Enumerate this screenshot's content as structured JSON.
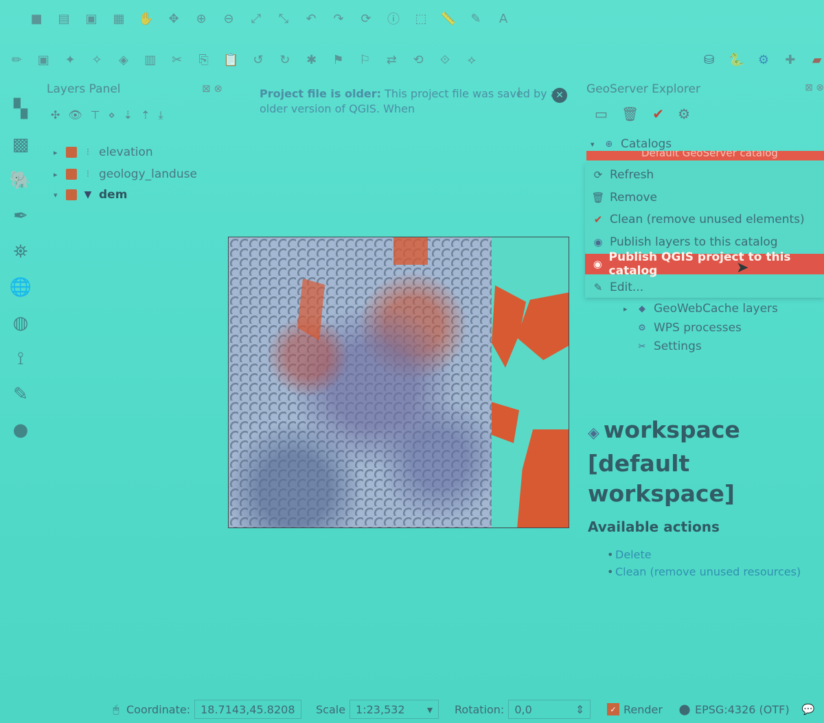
{
  "layers_panel": {
    "title": "Layers Panel",
    "layers": [
      {
        "name": "elevation"
      },
      {
        "name": "geology_landuse"
      },
      {
        "name": "dem"
      }
    ]
  },
  "message_bar": {
    "bold_text": "Project file is older:",
    "text": " This project file was saved by an older version of QGIS. When"
  },
  "geoserver_explorer": {
    "title": "GeoServer Explorer",
    "tree": {
      "catalogs_label": "Catalogs",
      "selected_catalog": "Default GeoServer catalog",
      "geowebcache_label": "GeoWebCache layers",
      "wps_label": "WPS processes",
      "settings_label": "Settings"
    },
    "context_menu": [
      {
        "label": "Refresh",
        "icon": "refresh-icon"
      },
      {
        "label": "Remove",
        "icon": "trash-icon"
      },
      {
        "label": "Clean (remove unused elements)",
        "icon": "broom-icon"
      },
      {
        "label": "Publish layers to this catalog",
        "icon": "publish-icon"
      },
      {
        "label": "Publish QGIS project to this catalog",
        "icon": "publish-project-icon"
      },
      {
        "label": "Edit...",
        "icon": "edit-icon"
      }
    ],
    "details": {
      "title_line1": "workspace",
      "title_line2": "[default workspace]",
      "actions_heading": "Available actions",
      "actions": [
        {
          "label": "Delete"
        },
        {
          "label": "Clean (remove unused resources)"
        }
      ]
    }
  },
  "status_bar": {
    "coordinate_label": "Coordinate:",
    "coordinate_value": "18.7143,45.8208",
    "scale_label": "Scale",
    "scale_value": "1:23,532",
    "rotation_label": "Rotation:",
    "rotation_value": "0,0",
    "render_label": "Render",
    "crs_label": "EPSG:4326 (OTF)"
  },
  "colors": {
    "accent_red": "#e0554a",
    "background": "#55dccb",
    "vector_fill": "#d75a33"
  }
}
